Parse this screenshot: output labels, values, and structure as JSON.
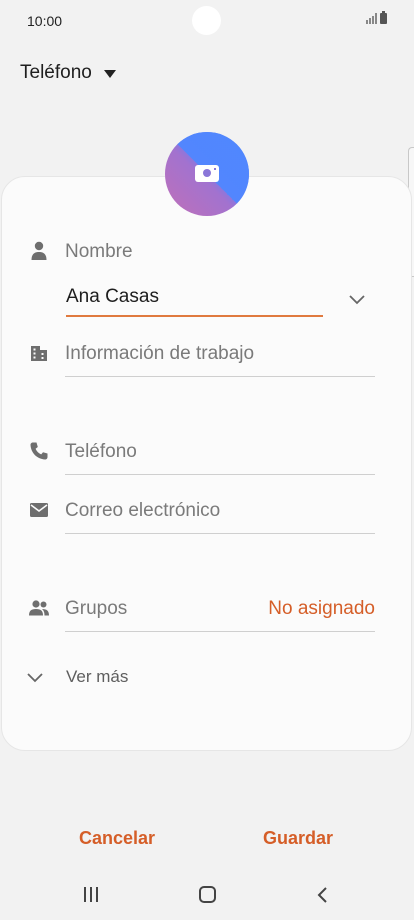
{
  "status_bar": {
    "time": "10:00"
  },
  "header": {
    "account": "Teléfono"
  },
  "form": {
    "name": {
      "label": "Nombre",
      "value": "Ana Casas"
    },
    "work": {
      "label": "Información de trabajo"
    },
    "phone": {
      "label": "Teléfono"
    },
    "email": {
      "label": "Correo electrónico"
    },
    "groups": {
      "label": "Grupos",
      "value": "No asignado"
    },
    "more": {
      "label": "Ver más"
    }
  },
  "footer": {
    "cancel_label": "Cancelar",
    "save_label": "Guardar"
  },
  "colors": {
    "accent": "#d55e28",
    "underline_active": "#e07a3f",
    "photo_gradient": [
      "#4f86f7",
      "#c070b8"
    ]
  },
  "icons": [
    "person-icon",
    "building-icon",
    "phone-icon",
    "email-icon",
    "group-icon",
    "camera-icon",
    "chevron-down-icon"
  ]
}
